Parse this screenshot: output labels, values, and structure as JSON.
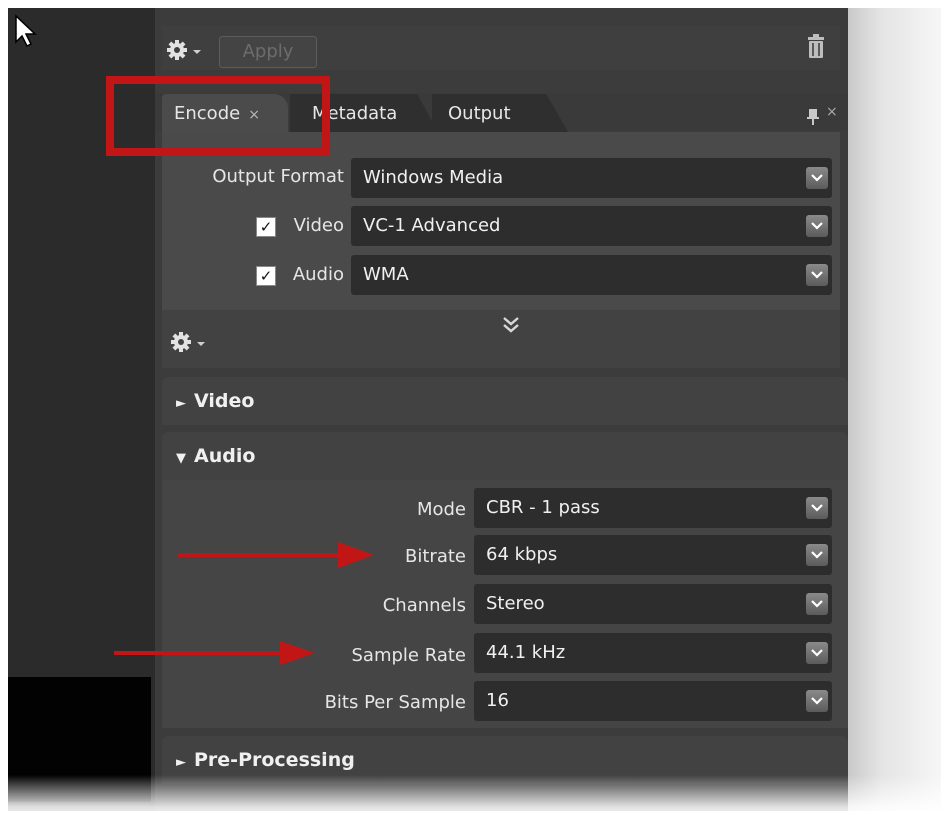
{
  "toolbar": {
    "apply_label": "Apply"
  },
  "tabs": [
    {
      "label": "Encode",
      "close": "×"
    },
    {
      "label": "Metadata"
    },
    {
      "label": "Output"
    }
  ],
  "panel": {
    "close": "×"
  },
  "encode": {
    "output_format_label": "Output Format",
    "output_format_value": "Windows Media",
    "video_label": "Video",
    "video_checked": true,
    "video_value": "VC-1 Advanced",
    "audio_label": "Audio",
    "audio_checked": true,
    "audio_value": "WMA"
  },
  "sections": {
    "video_header": "Video",
    "audio_header": "Audio",
    "preprocessing_header": "Pre-Processing"
  },
  "audio": {
    "mode_label": "Mode",
    "mode_value": "CBR - 1 pass",
    "bitrate_label": "Bitrate",
    "bitrate_value": "64 kbps",
    "channels_label": "Channels",
    "channels_value": "Stereo",
    "sample_rate_label": "Sample Rate",
    "sample_rate_value": "44.1 kHz",
    "bits_label": "Bits Per Sample",
    "bits_value": "16"
  },
  "glyphs": {
    "collapsed": "►",
    "expanded": "▼",
    "check": "✓"
  },
  "icons": [
    "cursor-arrow-icon",
    "gear-icon",
    "trash-icon",
    "pin-icon",
    "close-icon",
    "chevron-down-icon",
    "double-chevron-down-icon"
  ],
  "colors": {
    "panel_bg": "#3c3c3c",
    "dropdown_bg": "#2d2d2d",
    "annotation_red": "#c21616",
    "text": "#e6e6e6"
  }
}
